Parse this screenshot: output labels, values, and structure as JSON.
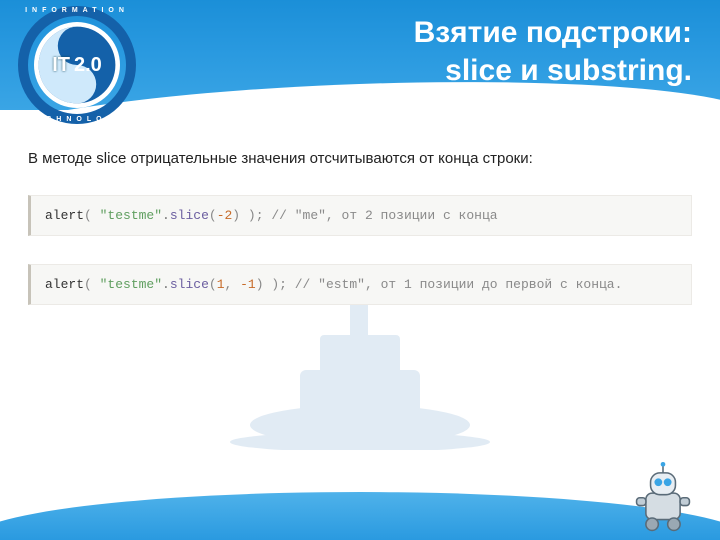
{
  "logo": {
    "ring_top": "INFORMATION",
    "ring_bottom": "TECHNOLOGY",
    "left_label": "IT",
    "right_label": "2.0"
  },
  "header": {
    "title_line1": "Взятие подстроки:",
    "title_line2": "slice и substring."
  },
  "intro": "В методе slice отрицательные значения отсчитываются от конца строки:",
  "code1": {
    "fn": "alert",
    "str": "\"testme\"",
    "method": "slice",
    "args": "-2",
    "comment": "// \"me\", от 2 позиции с конца"
  },
  "code2": {
    "fn": "alert",
    "str": "\"testme\"",
    "method": "slice",
    "arg1": "1",
    "arg2": "-1",
    "comment": "// \"estm\", от 1 позиции до первой с конца."
  }
}
